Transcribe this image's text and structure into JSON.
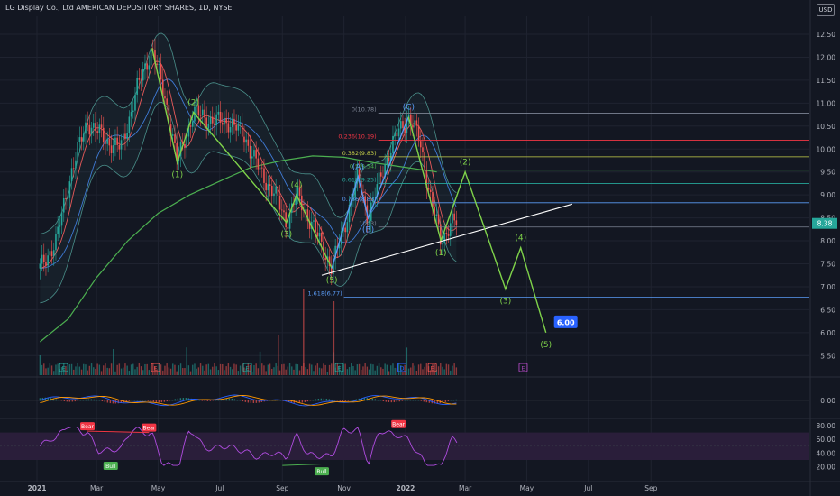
{
  "header": {
    "title": "LG Display Co., Ltd AMERICAN DEPOSITORY SHARES, 1D, NYSE",
    "currency": "USD"
  },
  "colors": {
    "background": "#131722",
    "grid": "#1f2330",
    "axis_text": "#b2b5be",
    "wave_green": "#7fd34a",
    "wave_blue": "#5b9cf6",
    "trendline": "#ffffff",
    "ma200": "#4caf50",
    "ma_red": "#e85a5a",
    "ma_blue": "#3f7bd6",
    "bb": "#4a8f8a",
    "up": "#26a69a",
    "down": "#ef5350",
    "rsi": "#b04ce0",
    "rsi_band": "#2a1e3a",
    "bull": "#4caf50",
    "bear": "#f23645",
    "target": "#2962ff",
    "event_green": "#26a69a",
    "event_red": "#ef5350",
    "event_blue": "#2962ff",
    "event_purple": "#ab47bc"
  },
  "chart_data": {
    "type": "candlestick",
    "title": "LG Display Co., Ltd AMERICAN DEPOSITORY SHARES, 1D, NYSE",
    "x_ticks": [
      "2021",
      "Mar",
      "May",
      "Jul",
      "Sep",
      "Nov",
      "2022",
      "Mar",
      "May",
      "Jul",
      "Sep"
    ],
    "y_ticks": [
      "12.50",
      "12.00",
      "11.50",
      "11.00",
      "10.50",
      "10.00",
      "9.50",
      "9.00",
      "8.50",
      "8.00",
      "7.50",
      "7.00",
      "6.50",
      "6.00",
      "5.50"
    ],
    "ylim": [
      5.2,
      12.8
    ],
    "last_price": "8.38",
    "price_path": [
      {
        "d": "2021-01-04",
        "v": 7.4
      },
      {
        "d": "2021-01-20",
        "v": 8.0
      },
      {
        "d": "2021-02-05",
        "v": 9.6
      },
      {
        "d": "2021-02-20",
        "v": 10.6
      },
      {
        "d": "2021-03-10",
        "v": 10.2
      },
      {
        "d": "2021-03-25",
        "v": 10.0
      },
      {
        "d": "2021-04-10",
        "v": 11.3
      },
      {
        "d": "2021-04-25",
        "v": 12.2
      },
      {
        "d": "2021-05-10",
        "v": 10.9
      },
      {
        "d": "2021-05-20",
        "v": 9.7
      },
      {
        "d": "2021-06-05",
        "v": 10.8
      },
      {
        "d": "2021-06-25",
        "v": 10.6
      },
      {
        "d": "2021-07-10",
        "v": 10.6
      },
      {
        "d": "2021-07-25",
        "v": 10.3
      },
      {
        "d": "2021-08-10",
        "v": 9.5
      },
      {
        "d": "2021-08-25",
        "v": 9.0
      },
      {
        "d": "2021-09-05",
        "v": 8.4
      },
      {
        "d": "2021-09-15",
        "v": 9.0
      },
      {
        "d": "2021-09-25",
        "v": 8.6
      },
      {
        "d": "2021-10-10",
        "v": 7.9
      },
      {
        "d": "2021-10-20",
        "v": 7.4
      },
      {
        "d": "2021-11-01",
        "v": 8.3
      },
      {
        "d": "2021-11-15",
        "v": 9.4
      },
      {
        "d": "2021-11-25",
        "v": 8.5
      },
      {
        "d": "2021-12-10",
        "v": 9.6
      },
      {
        "d": "2021-12-25",
        "v": 10.4
      },
      {
        "d": "2022-01-04",
        "v": 10.7
      },
      {
        "d": "2022-01-15",
        "v": 10.2
      },
      {
        "d": "2022-01-25",
        "v": 9.0
      },
      {
        "d": "2022-02-05",
        "v": 8.0
      },
      {
        "d": "2022-02-15",
        "v": 8.4
      },
      {
        "d": "2022-02-22",
        "v": 8.38
      }
    ],
    "ma200": [
      {
        "d": "2021-01-04",
        "v": 5.8
      },
      {
        "d": "2021-02-01",
        "v": 6.3
      },
      {
        "d": "2021-03-01",
        "v": 7.2
      },
      {
        "d": "2021-04-01",
        "v": 8.0
      },
      {
        "d": "2021-05-01",
        "v": 8.6
      },
      {
        "d": "2021-06-01",
        "v": 9.0
      },
      {
        "d": "2021-07-01",
        "v": 9.3
      },
      {
        "d": "2021-08-01",
        "v": 9.6
      },
      {
        "d": "2021-09-01",
        "v": 9.75
      },
      {
        "d": "2021-10-01",
        "v": 9.85
      },
      {
        "d": "2021-11-01",
        "v": 9.82
      },
      {
        "d": "2021-12-01",
        "v": 9.7
      },
      {
        "d": "2022-01-01",
        "v": 9.6
      },
      {
        "d": "2022-02-01",
        "v": 9.5
      }
    ],
    "fibonacci": [
      {
        "ratio": "0(10.78)",
        "price": 10.78,
        "color": "#7d8494"
      },
      {
        "ratio": "0.236(10.19)",
        "price": 10.19,
        "color": "#f23645"
      },
      {
        "ratio": "0.382(9.83)",
        "price": 9.83,
        "color": "#c9d34a"
      },
      {
        "ratio": "0.5(9.54)",
        "price": 9.54,
        "color": "#4caf50"
      },
      {
        "ratio": "0.618(9.25)",
        "price": 9.25,
        "color": "#26a69a"
      },
      {
        "ratio": "0.786(8.83)",
        "price": 8.83,
        "color": "#5b9cf6"
      },
      {
        "ratio": "1(8.3)",
        "price": 8.3,
        "color": "#7d8494"
      },
      {
        "ratio": "1.618(6.77)",
        "price": 6.77,
        "color": "#5b9cf6"
      }
    ],
    "elliott_waves": [
      {
        "label": "(1)",
        "d": "2021-05-20",
        "v": 9.7,
        "color": "green",
        "pos": "below"
      },
      {
        "label": "(2)",
        "d": "2021-06-05",
        "v": 10.8,
        "color": "green",
        "pos": "above"
      },
      {
        "label": "(3)",
        "d": "2021-09-05",
        "v": 8.4,
        "color": "green",
        "pos": "below"
      },
      {
        "label": "(4)",
        "d": "2021-09-15",
        "v": 9.0,
        "color": "green",
        "pos": "above"
      },
      {
        "label": "(5)",
        "d": "2021-10-20",
        "v": 7.4,
        "color": "green",
        "pos": "below"
      },
      {
        "label": "(A)",
        "d": "2021-11-15",
        "v": 9.4,
        "color": "blue",
        "pos": "above"
      },
      {
        "label": "(B)",
        "d": "2021-11-25",
        "v": 8.5,
        "color": "blue",
        "pos": "below"
      },
      {
        "label": "(C)",
        "d": "2022-01-04",
        "v": 10.7,
        "color": "blue",
        "pos": "above"
      },
      {
        "label": "(1)",
        "d": "2022-02-05",
        "v": 8.0,
        "color": "green",
        "pos": "below"
      },
      {
        "label": "(2)",
        "d": "2022-03-01",
        "v": 9.5,
        "color": "green",
        "pos": "above"
      },
      {
        "label": "(3)",
        "d": "2022-04-10",
        "v": 6.95,
        "color": "green",
        "pos": "below"
      },
      {
        "label": "(4)",
        "d": "2022-04-25",
        "v": 7.85,
        "color": "green",
        "pos": "above"
      },
      {
        "label": "(5)",
        "d": "2022-05-20",
        "v": 6.0,
        "color": "green",
        "pos": "below"
      }
    ],
    "projection": [
      {
        "d": "2022-02-05",
        "v": 8.0
      },
      {
        "d": "2022-03-01",
        "v": 9.5
      },
      {
        "d": "2022-04-10",
        "v": 6.95
      },
      {
        "d": "2022-04-25",
        "v": 7.85
      },
      {
        "d": "2022-05-20",
        "v": 6.0
      }
    ],
    "trendline": [
      {
        "d": "2021-10-10",
        "v": 7.25
      },
      {
        "d": "2022-06-15",
        "v": 8.8
      }
    ],
    "target_label": "6.00",
    "rsi": {
      "y_ticks": [
        "80.00",
        "60.00",
        "40.00",
        "20.00"
      ],
      "band": [
        70,
        30
      ],
      "divergences": [
        {
          "label": "Bear",
          "type": "bear",
          "d": "2021-02-20",
          "v": 72
        },
        {
          "label": "Bear",
          "type": "bear",
          "d": "2021-04-22",
          "v": 70
        },
        {
          "label": "Bull",
          "type": "bull",
          "d": "2021-03-15",
          "v": 30
        },
        {
          "label": "Bull",
          "type": "bull",
          "d": "2021-10-10",
          "v": 22
        },
        {
          "label": "Bear",
          "type": "bear",
          "d": "2021-12-25",
          "v": 75
        }
      ]
    },
    "macd": {
      "y_ticks": [
        "0.00"
      ]
    },
    "events": [
      {
        "label": "E",
        "d": "2021-01-27",
        "color": "green"
      },
      {
        "label": "E",
        "d": "2021-04-28",
        "color": "red"
      },
      {
        "label": "E",
        "d": "2021-07-28",
        "color": "green"
      },
      {
        "label": "E",
        "d": "2021-10-27",
        "color": "green"
      },
      {
        "label": "D",
        "d": "2021-12-28",
        "color": "blue"
      },
      {
        "label": "E",
        "d": "2022-01-27",
        "color": "red"
      },
      {
        "label": "E",
        "d": "2022-04-27",
        "color": "purple"
      }
    ]
  }
}
